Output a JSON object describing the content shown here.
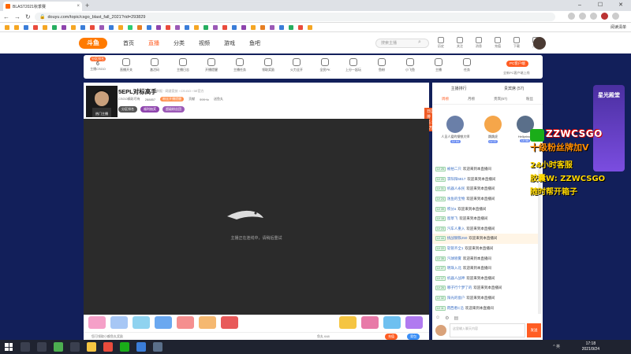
{
  "browser": {
    "tab_title": "BLAST2021秋季赛",
    "url": "douyu.com/topic/csgo_blast_fall_2021?rid=293829",
    "reading_list": "阅读清单"
  },
  "site": {
    "logo": "斗鱼",
    "nav": [
      "首页",
      "直播",
      "分类",
      "视频",
      "游戏",
      "鱼吧"
    ],
    "search_placeholder": "搜索主播",
    "header_icons": [
      "历史",
      "关注",
      "消息",
      "充值",
      "下载",
      "开播"
    ]
  },
  "categories": {
    "first_badge": "分区排名",
    "first_num": "6",
    "first_label": "主播CSGO",
    "items": [
      "直播开关",
      "激活码",
      "主播日志",
      "开播提醒",
      "主播任务",
      "领取奖励",
      "火力全开",
      "全民PK",
      "上分一起玩",
      "鱼粉",
      "小飞鱼",
      "主播",
      "任务"
    ],
    "pc_client": "PC客户端",
    "pc_sub": "全新PC客户端上线"
  },
  "streamer": {
    "name": "5EPL对标高手",
    "category_path": "举报 · 网游竞技 › CS:GO › 5E官方",
    "meta": [
      "CSGO精彩尽有",
      "288857",
      "粉丝开播提醒",
      "贡献",
      "999+lv",
      "送鱼丸"
    ],
    "tags": [
      "分区排名",
      "福利抽奖",
      "超级粉丝团"
    ],
    "avatar_caption": "热门主播",
    "fans": "497479",
    "follow": "关注",
    "live_badge": "日区排名：1万",
    "share": "分享",
    "report": "福利任务"
  },
  "player": {
    "loading_text": "主播正在连线中，请稍后重试"
  },
  "bottom": {
    "left_text": "您可领取小额鱼丸奖励",
    "right_text": "鱼丸 648",
    "recharge": "充值",
    "backpack": "背包"
  },
  "rightpanel": {
    "top_tabs": [
      "主播排行",
      "贵宾席 (57)"
    ],
    "tabs": [
      "周榜",
      "月榜",
      "贵宾(67)",
      "粉丝"
    ],
    "top_users": [
      {
        "name": "人见人爱的钢铁大师",
        "lv": "LV 64"
      },
      {
        "name": "跳跳虎",
        "lv": "LV 37"
      },
      {
        "name": "Hellprince",
        "lv": "LV 58"
      }
    ],
    "chat": [
      {
        "lv": "LV 25",
        "user": "被拍二只",
        "text": "欢迎来到本直播间",
        "special": false
      },
      {
        "lv": "LV 20",
        "user": "李阳阳5817",
        "text": "欢迎来到本直播间",
        "special": false
      },
      {
        "lv": "LV 31",
        "user": "机器人永民",
        "text": "欢迎来到本直播间",
        "special": false
      },
      {
        "lv": "LV 24",
        "user": "逸鱼的宝物",
        "text": "欢迎来到本直播间",
        "special": false
      },
      {
        "lv": "LV 39",
        "user": "积分a",
        "text": "欢迎来到本直播间",
        "special": false
      },
      {
        "lv": "LV 18",
        "user": "窗草飞",
        "text": "欢迎来到本直播间",
        "special": false
      },
      {
        "lv": "LV 23",
        "user": "汽车人重入",
        "text": "欢迎来到本直播间",
        "special": false
      },
      {
        "lv": "LV 44",
        "user": "挑战钢铁250",
        "text": "欢迎来到本直播间",
        "special": true
      },
      {
        "lv": "LV 22",
        "user": "软管齐全1",
        "text": "欢迎来到本直播间",
        "special": false
      },
      {
        "lv": "LV 35",
        "user": "汽球喷雾",
        "text": "欢迎来到本直播间",
        "special": false
      },
      {
        "lv": "LV 27",
        "user": "明珠入北",
        "text": "欢迎来到本直播间",
        "special": false
      },
      {
        "lv": "LV 17",
        "user": "机器人战神",
        "text": "欢迎来到本直播间",
        "special": false
      },
      {
        "lv": "LV 26",
        "user": "哪子行个梦了的",
        "text": "欢迎来到本直播间",
        "special": false
      },
      {
        "lv": "LV 32",
        "user": "阳光的窗户",
        "text": "欢迎来到本直播间",
        "special": false
      },
      {
        "lv": "LV 11",
        "user": "荷西者C沿",
        "text": "欢迎来到本直播间",
        "special": false
      },
      {
        "lv": "LV 23",
        "user": "李峰金",
        "text": "欢迎来到本直播间",
        "special": false
      }
    ],
    "input_placeholder": "这里输入聊天内容",
    "send": "发送"
  },
  "overlay": {
    "line1": "ZZWCSGO",
    "line2": "十级粉丝牌加V",
    "line3": "24小时客服",
    "line4": "胶囊W: ZZWCSGO",
    "line5": "随时帮开箱子",
    "promo": "星光殿堂"
  },
  "taskbar": {
    "time": "17:18",
    "date": "2021/9/24",
    "tray": "^ 英"
  },
  "colors": {
    "accent": "#ff5d23",
    "page_bg": "#121f5a"
  }
}
